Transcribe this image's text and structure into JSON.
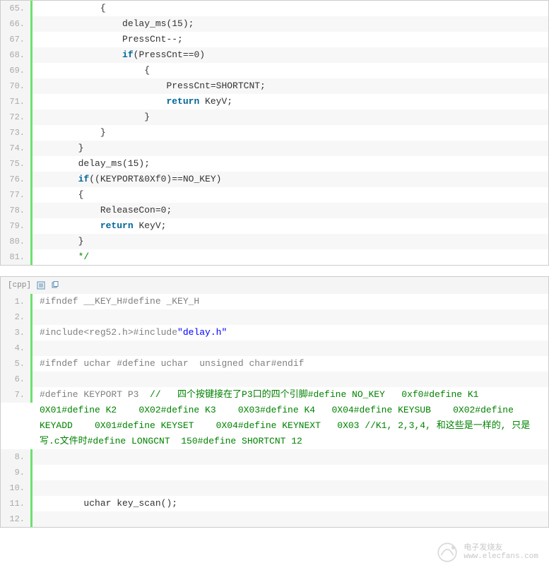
{
  "block1": {
    "lines": [
      {
        "n": "65.",
        "code": "           {"
      },
      {
        "n": "66.",
        "code": "               delay_ms(15);"
      },
      {
        "n": "67.",
        "code": "               PressCnt--;"
      },
      {
        "n": "68.",
        "code": "               if(PressCnt==0)"
      },
      {
        "n": "69.",
        "code": "                   {"
      },
      {
        "n": "70.",
        "code": "                       PressCnt=SHORTCNT;"
      },
      {
        "n": "71.",
        "code": "                       return KeyV;"
      },
      {
        "n": "72.",
        "code": "                   }"
      },
      {
        "n": "73.",
        "code": "           }"
      },
      {
        "n": "74.",
        "code": "       }"
      },
      {
        "n": "75.",
        "code": "       delay_ms(15);"
      },
      {
        "n": "76.",
        "code": "       if((KEYPORT&0Xf0)==NO_KEY)"
      },
      {
        "n": "77.",
        "code": "       {"
      },
      {
        "n": "78.",
        "code": "           ReleaseCon=0;"
      },
      {
        "n": "79.",
        "code": "           return KeyV;"
      },
      {
        "n": "80.",
        "code": "       }"
      },
      {
        "n": "81.",
        "code": "       */"
      }
    ]
  },
  "block2": {
    "lang": "[cpp]",
    "lines": [
      {
        "n": "1.",
        "code": "#ifndef __KEY_H#define _KEY_H"
      },
      {
        "n": "2.",
        "code": ""
      },
      {
        "n": "3.",
        "code": "#include<reg52.h>#include\"delay.h\""
      },
      {
        "n": "4.",
        "code": ""
      },
      {
        "n": "5.",
        "code": "#ifndef uchar #define uchar  unsigned char#endif"
      },
      {
        "n": "6.",
        "code": ""
      },
      {
        "n": "7.",
        "code": "#define KEYPORT P3  //   四个按键接在了P3口的四个引脚#define NO_KEY   0xf0#define K1    0X01#define K2    0X02#define K3    0X03#define K4   0X04#define KEYSUB    0X02#define KEYADD    0X01#define KEYSET    0X04#define KEYNEXT   0X03 //K1, 2,3,4, 和这些是一样的, 只是写.c文件时#define LONGCNT  150#define SHORTCNT 12"
      },
      {
        "n": "8.",
        "code": ""
      },
      {
        "n": "9.",
        "code": ""
      },
      {
        "n": "10.",
        "code": ""
      },
      {
        "n": "11.",
        "code": "        uchar key_scan();"
      },
      {
        "n": "12.",
        "code": ""
      }
    ]
  },
  "watermark": {
    "t1": "电子发烧友",
    "t2": "www.elecfans.com"
  }
}
